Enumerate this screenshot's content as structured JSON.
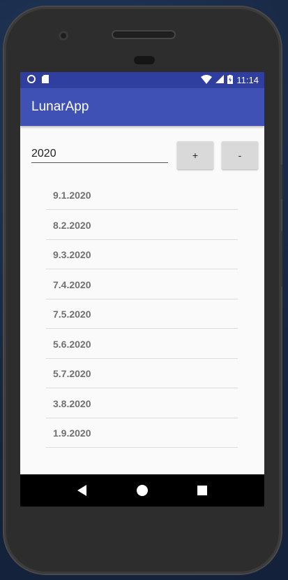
{
  "status_bar": {
    "time": "11:14",
    "left_icons": [
      "notification-dot-icon",
      "sd-card-icon"
    ],
    "right_icons": [
      "wifi-icon",
      "signal-icon",
      "battery-charging-icon"
    ]
  },
  "app_bar": {
    "title": "LunarApp"
  },
  "year_field": {
    "value": "2020"
  },
  "buttons": {
    "plus_label": "+",
    "minus_label": "-"
  },
  "dates": [
    "9.1.2020",
    "8.2.2020",
    "9.3.2020",
    "7.4.2020",
    "7.5.2020",
    "5.6.2020",
    "5.7.2020",
    "3.8.2020",
    "1.9.2020"
  ],
  "nav_bar": {
    "icons": [
      "back-icon",
      "home-icon",
      "recents-icon"
    ]
  },
  "colors": {
    "primary": "#3f51b5",
    "primary_dark": "#303f9f",
    "background": "#fafafa"
  }
}
